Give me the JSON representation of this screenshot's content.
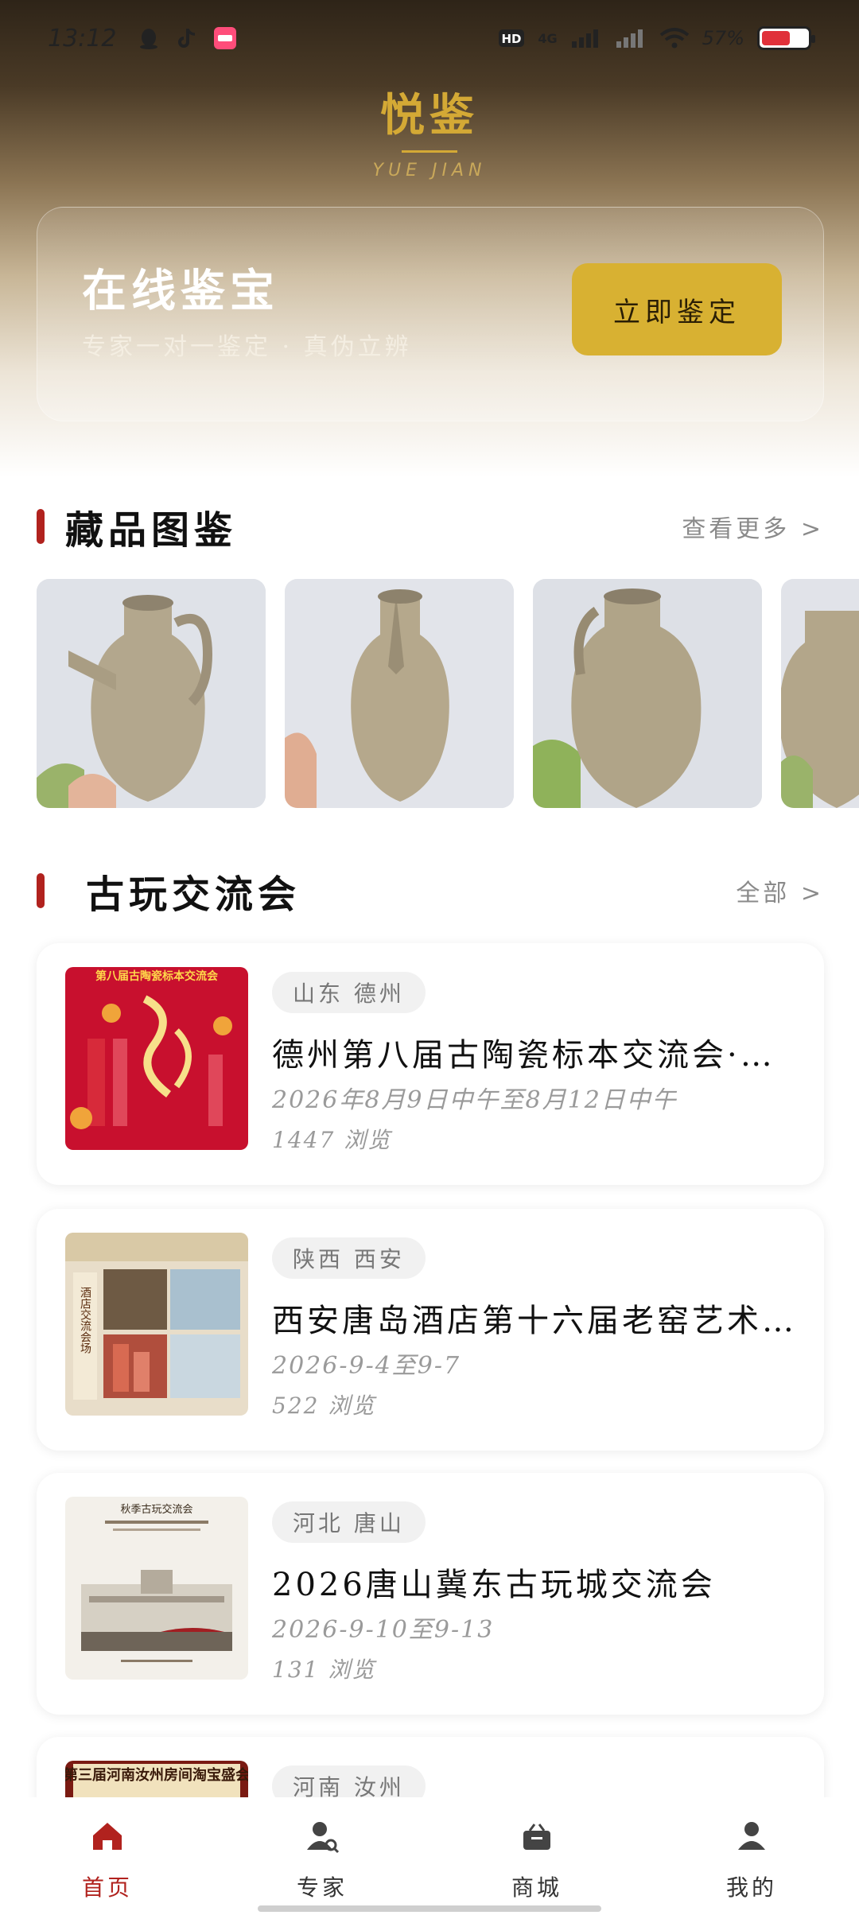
{
  "status_bar": {
    "time": "13:12",
    "battery_percent": "57%",
    "network": "4G"
  },
  "brand": {
    "name_cn": "悦鉴",
    "name_en": "YUE JIAN",
    "accent": "#d4a935"
  },
  "hero": {
    "title": "在线鉴宝",
    "subtitle": "专家一对一鉴定 · 真伪立辨",
    "button_label": "立即鉴定"
  },
  "collection": {
    "title": "藏品图鉴",
    "more_label": "查看更多 >",
    "items": [
      {
        "icon": "ewer-photo"
      },
      {
        "icon": "ewer-photo"
      },
      {
        "icon": "ewer-photo"
      },
      {
        "icon": "ewer-photo"
      }
    ]
  },
  "exchange": {
    "title": "古玩交流会",
    "more_label": "全部 >",
    "events": [
      {
        "location": "山东 德州",
        "title": "德州第八届古陶瓷标本交流会·老窑瓷器收藏鉴赏",
        "date": "2026年8月9日中午至8月12日中午",
        "views": "1447 浏览",
        "poster_caption": "第八届古陶瓷标本交流会",
        "poster_color": "#c8102e"
      },
      {
        "location": "陕西 西安",
        "title": "西安唐岛酒店第十六届老窑艺术品交流会",
        "date": "2026-9-4至9-7",
        "views": "522 浏览",
        "poster_caption": "酒店交流会场",
        "poster_color": "#e8ddc9"
      },
      {
        "location": "河北 唐山",
        "title": "2026唐山冀东古玩城交流会",
        "date": "2026-9-10至9-13",
        "views": "131 浏览",
        "poster_caption": "秋季古玩交流会",
        "poster_color": "#f3f0ea"
      },
      {
        "location": "河南 汝州",
        "title": "",
        "date": "",
        "views": "",
        "poster_caption": "第三届河南汝州房间淘宝盛会",
        "poster_color": "#e9d9b6"
      }
    ]
  },
  "nav": {
    "items": [
      {
        "label": "首页",
        "icon": "home-icon",
        "active": true
      },
      {
        "label": "专家",
        "icon": "expert-icon",
        "active": false
      },
      {
        "label": "商城",
        "icon": "shop-icon",
        "active": false
      },
      {
        "label": "我的",
        "icon": "profile-icon",
        "active": false
      }
    ],
    "active_color": "#b1221e"
  }
}
